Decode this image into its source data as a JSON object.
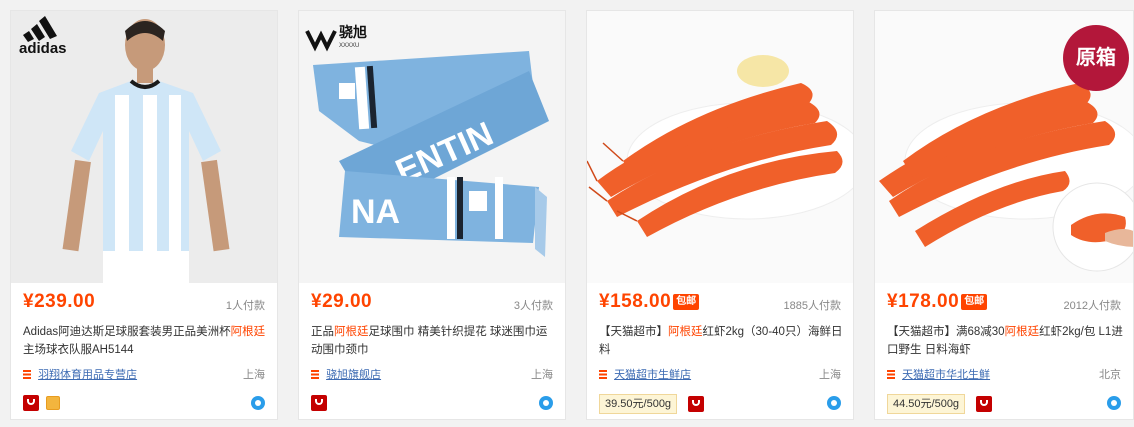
{
  "products": [
    {
      "brand_logo": "adidas",
      "price": "¥239.00",
      "sales": "1人付款",
      "title_parts": [
        {
          "text": "Adidas阿迪达斯足球服套装男正品美洲杯",
          "hl": false
        },
        {
          "text": "阿根廷",
          "hl": true
        },
        {
          "text": "主场球衣队服AH5144",
          "hl": false
        }
      ],
      "shop": "羽翔体育用品专营店",
      "location": "上海",
      "unit_price": "",
      "badges": [
        "tmall-icon",
        "gold-icon"
      ]
    },
    {
      "brand_logo": "骁旭",
      "brand_logo_sub": "XXXXU",
      "scarf_text": "ENTIN",
      "scarf_text2": "NA",
      "price": "¥29.00",
      "sales": "3人付款",
      "title_parts": [
        {
          "text": "正品",
          "hl": false
        },
        {
          "text": "阿根廷",
          "hl": true
        },
        {
          "text": "足球围巾 精美针织提花 球迷围巾运动围巾颈巾",
          "hl": false
        }
      ],
      "shop": "骁旭旗舰店",
      "location": "上海",
      "unit_price": "",
      "badges": [
        "tmall-icon"
      ]
    },
    {
      "price": "¥158.00",
      "price_badge": "包邮",
      "sales": "1885人付款",
      "title_parts": [
        {
          "text": "【天猫超市】",
          "hl": false
        },
        {
          "text": "阿根廷",
          "hl": true
        },
        {
          "text": "红虾2kg（30-40只）海鲜日料",
          "hl": false
        }
      ],
      "shop": "天猫超市生鲜店",
      "location": "上海",
      "unit_price": "39.50元/500g",
      "badges": [
        "tmall-icon"
      ]
    },
    {
      "price": "¥178.00",
      "price_badge": "包邮",
      "sales": "2012人付款",
      "overlay_badge": "原箱",
      "title_parts": [
        {
          "text": "【天猫超市】满68减30",
          "hl": false
        },
        {
          "text": "阿根廷",
          "hl": true
        },
        {
          "text": "红虾2kg/包 L1进口野生 日料海虾",
          "hl": false
        }
      ],
      "shop": "天猫超市华北生鲜",
      "location": "北京",
      "unit_price": "44.50元/500g",
      "badges": [
        "tmall-icon"
      ]
    }
  ],
  "colors": {
    "price": "#ff4400",
    "highlight": "#ff4400",
    "shop_link": "#3d6bb3",
    "tmall_red": "#c40000",
    "wangwang": "#2a9dea",
    "overlay_badge": "#b3173a"
  }
}
